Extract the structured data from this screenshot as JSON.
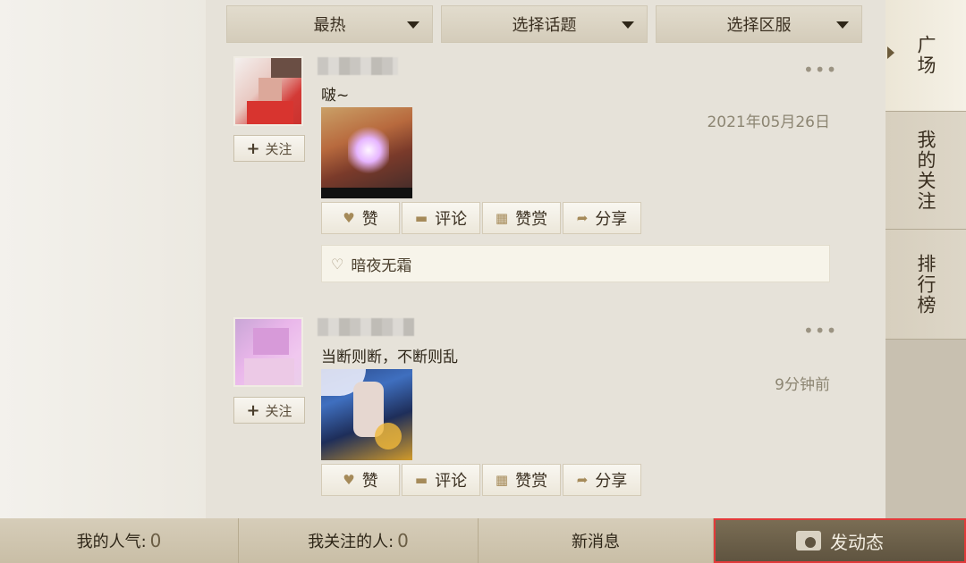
{
  "filters": [
    {
      "label": "最热"
    },
    {
      "label": "选择话题"
    },
    {
      "label": "选择区服"
    }
  ],
  "posts": [
    {
      "text": "啵~",
      "date": "2021年05月26日",
      "follow_label": "关注",
      "actions": {
        "like": "赞",
        "comment": "评论",
        "reward": "赞赏",
        "share": "分享"
      },
      "liked_by": "暗夜无霜",
      "more": "•••"
    },
    {
      "text": "当断则断，不断则乱",
      "date": "9分钟前",
      "follow_label": "关注",
      "actions": {
        "like": "赞",
        "comment": "评论",
        "reward": "赞赏",
        "share": "分享"
      },
      "more": "•••"
    }
  ],
  "side_tabs": [
    {
      "label": "广场"
    },
    {
      "label": "我的关注"
    },
    {
      "label": "排行榜"
    }
  ],
  "bottom": {
    "popularity_label": "我的人气:",
    "popularity_value": "0",
    "following_label": "我关注的人:",
    "following_value": "0",
    "messages_label": "新消息",
    "post_label": "发动态"
  },
  "colors": {
    "accent_border": "#e23a3a",
    "gold_icon": "#a58a59"
  },
  "icons": {
    "like": "heart-icon",
    "comment": "speech-bubble-icon",
    "reward": "gift-icon",
    "share": "share-arrow-icon",
    "post": "camera-icon"
  }
}
